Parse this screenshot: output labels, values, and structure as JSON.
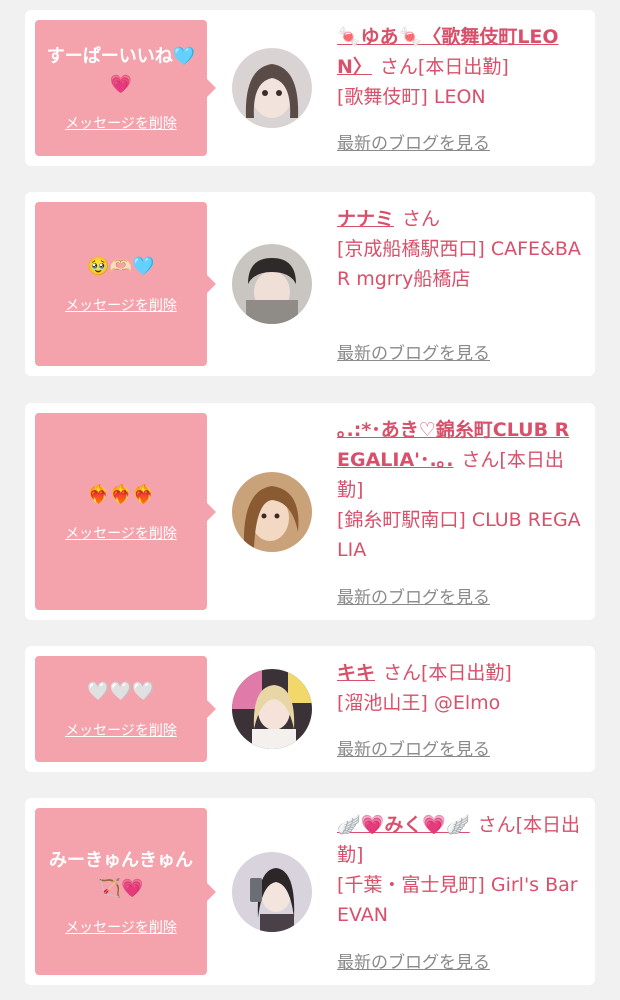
{
  "messages": [
    {
      "message": "すーぱーいいね🩵💗",
      "delete_label": "メッセージを削除",
      "avatar_icon": "avatar-photo-1",
      "name": "🍬ゆあ🍬〈歌舞伎町LEON〉",
      "honorific": "さん[本日出勤]",
      "shop": "[歌舞伎町] LEON",
      "blog_label": "最新のブログを見る"
    },
    {
      "message": "🥹🫶🏻🩵",
      "delete_label": "メッセージを削除",
      "avatar_icon": "avatar-photo-2",
      "name": "ナナミ",
      "honorific": "さん",
      "shop": "[京成船橋駅西口] CAFE&BAR mgrry船橋店",
      "blog_label": "最新のブログを見る"
    },
    {
      "message": "❤️‍🔥❤️‍🔥❤️‍🔥",
      "delete_label": "メッセージを削除",
      "avatar_icon": "avatar-photo-3",
      "name": "｡.:*･あき♡錦糸町CLUB REGALIA'･.｡.",
      "honorific": "さん[本日出勤]",
      "shop": "[錦糸町駅南口] CLUB REGALIA",
      "blog_label": "最新のブログを見る"
    },
    {
      "message": "🤍🤍🤍",
      "delete_label": "メッセージを削除",
      "avatar_icon": "avatar-photo-4",
      "name": "キキ",
      "honorific": "さん[本日出勤]",
      "shop": "[溜池山王] @Elmo",
      "blog_label": "最新のブログを見る"
    },
    {
      "message": "みーきゅんきゅん🏹💗",
      "delete_label": "メッセージを削除",
      "avatar_icon": "avatar-photo-5",
      "name": "🪽💗みく💗🪽",
      "honorific": "さん[本日出勤]",
      "shop": "[千葉・富士見町] Girl's Bar EVAN",
      "blog_label": "最新のブログを見る"
    }
  ],
  "colors": {
    "page_bg": "#f1f1f1",
    "card_bg": "#ffffff",
    "bubble_bg": "#f4a3ad",
    "accent": "#d8506a",
    "link_gray": "#8a8a8a"
  }
}
